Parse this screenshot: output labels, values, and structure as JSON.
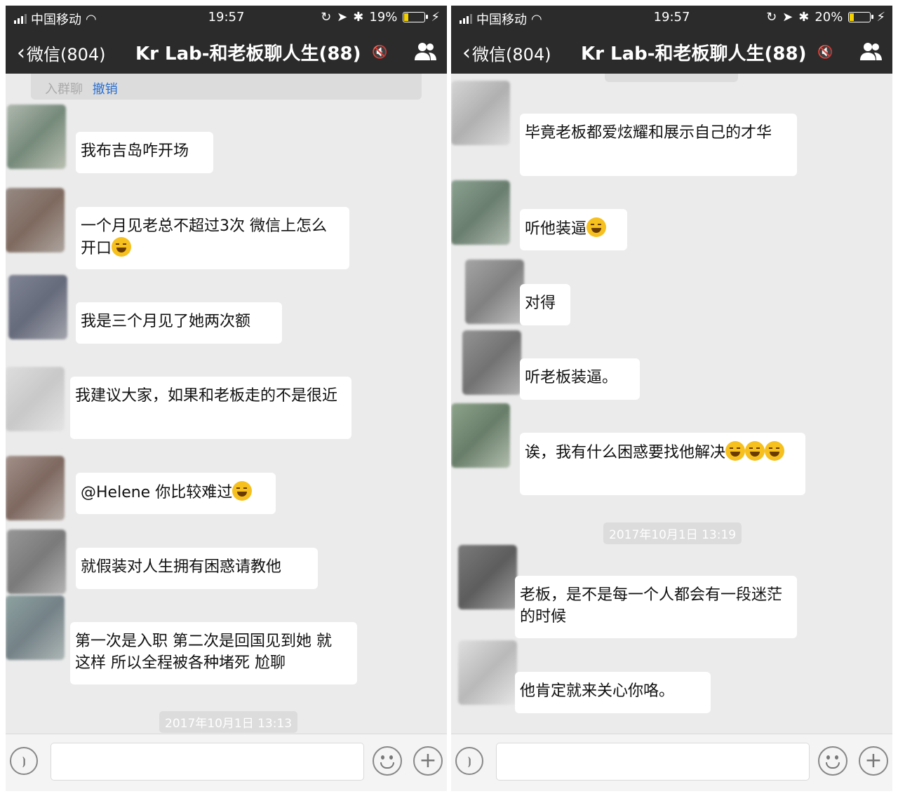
{
  "colors": {
    "nav_bg": "#2b2b2b",
    "chat_bg": "#ebebeb",
    "bubble": "#ffffff",
    "link": "#2a6fd1",
    "battery": "#f5d100"
  },
  "screens": [
    {
      "status": {
        "carrier": "中国移动",
        "time": "19:57",
        "battery": "19%",
        "battery_level": 0.19
      },
      "nav": {
        "back_label": "微信(804)",
        "title": "Kr Lab-和老板聊人生(88)"
      },
      "system_message": {
        "text": "入群聊",
        "action": "撤销"
      },
      "messages": [
        "我布吉岛咋开场",
        "一个月见老总不超过3次 微信上怎么开口",
        "我是三个月见了她两次额",
        "我建议大家，如果和老板走的不是很近",
        "@Helene 你比较难过",
        "就假装对人生拥有困惑请教他",
        "第一次是入职 第二次是回国见到她 就这样 所以全程被各种堵死 尬聊"
      ],
      "timestamp": "2017年10月1日 13:13"
    },
    {
      "status": {
        "carrier": "中国移动",
        "time": "19:57",
        "battery": "20%",
        "battery_level": 0.2
      },
      "nav": {
        "back_label": "微信(804)",
        "title": "Kr Lab-和老板聊人生(88)"
      },
      "messages": [
        "毕竟老板都爱炫耀和展示自己的才华",
        "听他装逼",
        "对得",
        "听老板装逼。",
        "诶，我有什么困惑要找他解决",
        "老板，是不是每一个人都会有一段迷茫的时候",
        "他肯定就来关心你咯。"
      ],
      "timestamp": "2017年10月1日 13:19"
    }
  ]
}
